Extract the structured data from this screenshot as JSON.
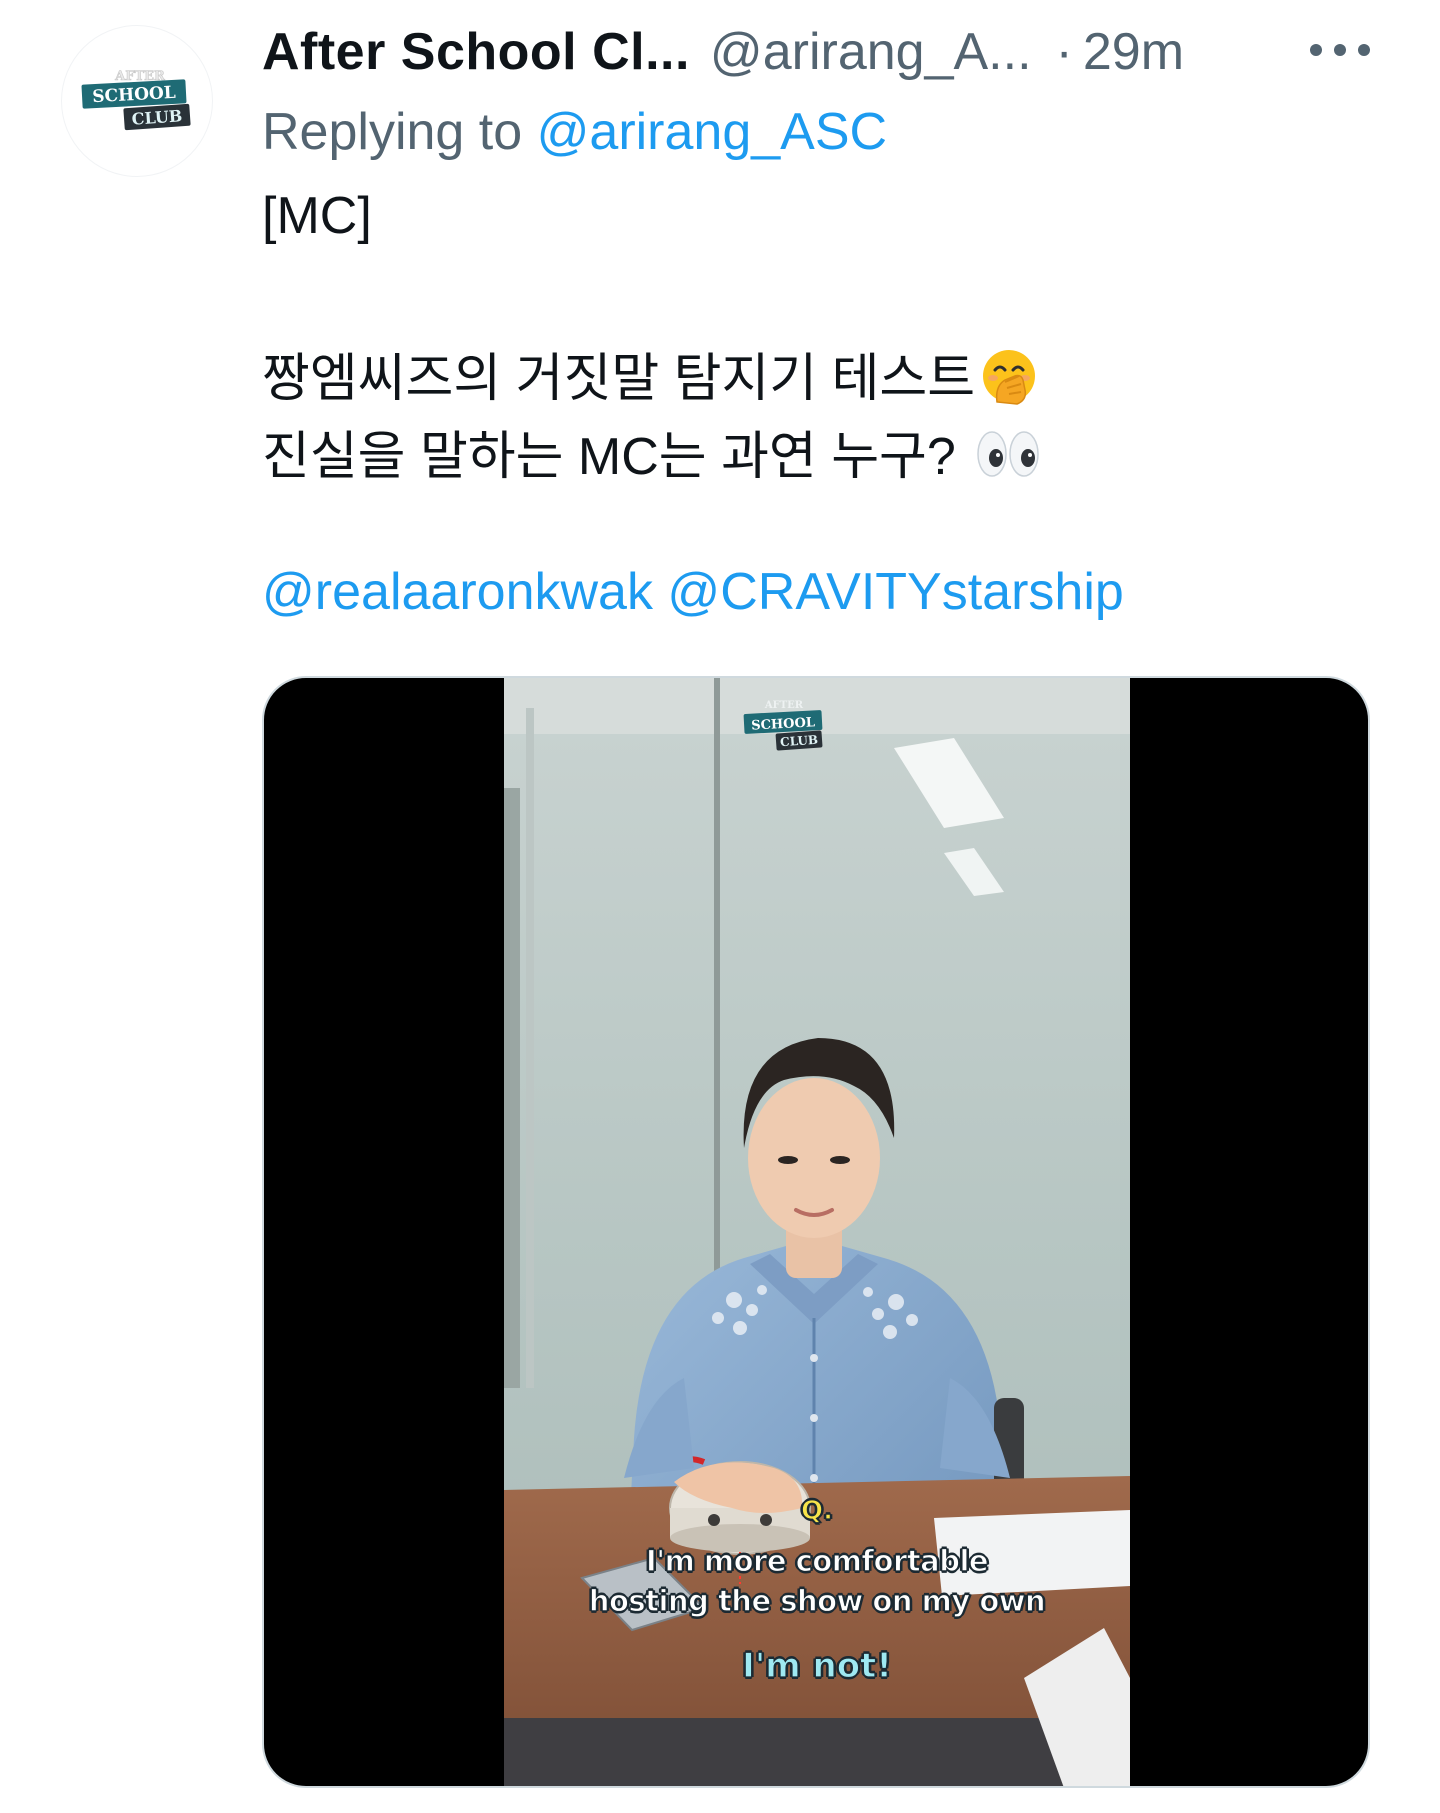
{
  "tweet": {
    "display_name": "After School Cl...",
    "handle": "@arirang_A...",
    "separator": "·",
    "time": "29m",
    "more_icon": "more-horizontal-icon",
    "replying_prefix": "Replying to",
    "replying_to": "@arirang_ASC",
    "text_line_1": "[MC]",
    "text_line_2": "짱엠씨즈의 거짓말 탐지기 테스트",
    "text_line_2_emoji": "hand-over-mouth-emoji",
    "text_line_3": "진실을 말하는 MC는 과연 누구?",
    "text_line_3_emoji": "eyes-emoji",
    "mention_1": "@realaaronkwak",
    "mention_2": "@CRAVITYstarship",
    "avatar_logo": {
      "line_1": "AFTER",
      "line_2": "SCHOOL",
      "line_3": "CLUB"
    },
    "media": {
      "watermark": {
        "line_1": "AFTER",
        "line_2": "SCHOOL",
        "line_3": "CLUB"
      },
      "caption_q": "Q.",
      "caption_line_1": "I'm more comfortable",
      "caption_line_2": "hosting the show on my own",
      "caption_answer": "I'm not!"
    }
  },
  "colors": {
    "text_primary": "#0f1419",
    "text_secondary": "#536471",
    "link": "#1d9bf0",
    "media_border": "#cfd9de"
  }
}
